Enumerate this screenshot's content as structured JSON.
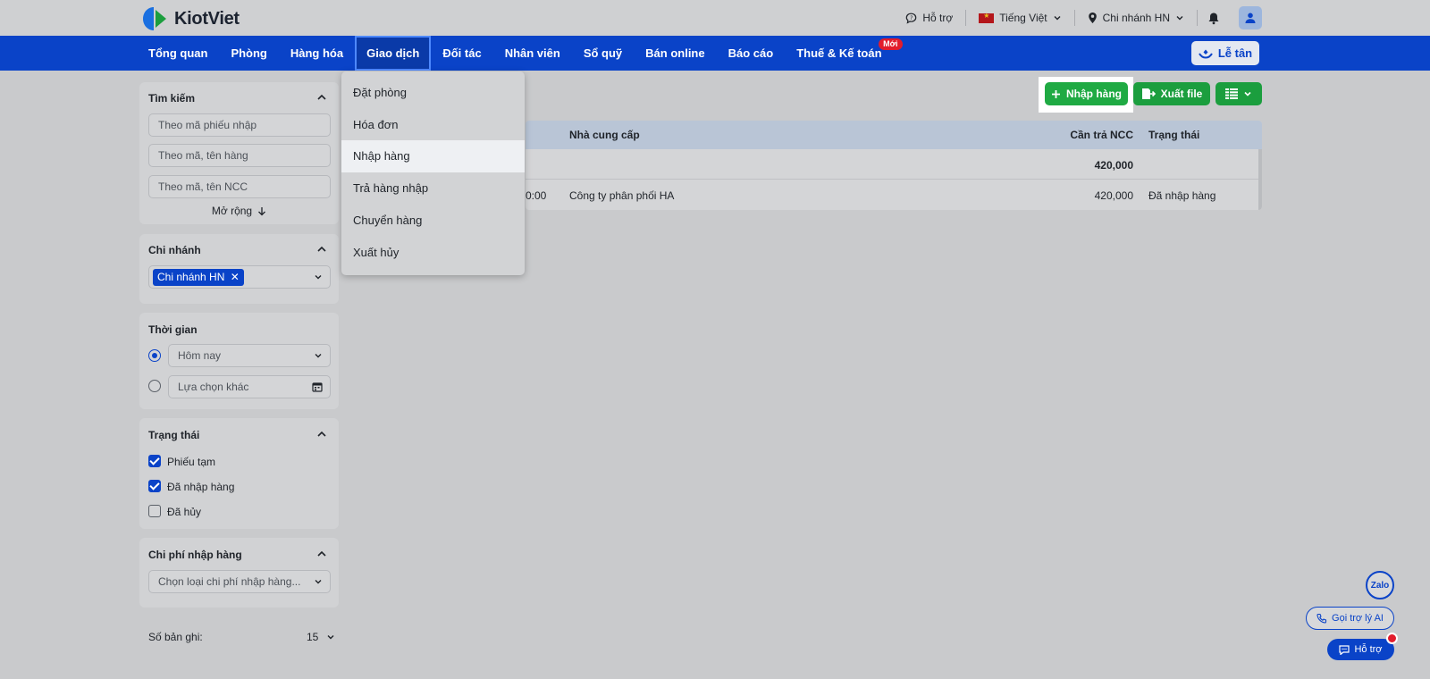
{
  "brand": {
    "name": "KiotViet"
  },
  "header": {
    "support": "Hỗ trợ",
    "language": "Tiếng Việt",
    "branch": "Chi nhánh HN"
  },
  "nav": {
    "items": [
      "Tổng quan",
      "Phòng",
      "Hàng hóa",
      "Giao dịch",
      "Đối tác",
      "Nhân viên",
      "Sổ quỹ",
      "Bán online",
      "Báo cáo",
      "Thuế & Kế toán"
    ],
    "active": "Giao dịch",
    "new_badge": "Mới",
    "reception": "Lễ tân"
  },
  "dropdown": {
    "items": [
      "Đặt phòng",
      "Hóa đơn",
      "Nhập hàng",
      "Trả hàng nhập",
      "Chuyển hàng",
      "Xuất hủy"
    ],
    "active": "Nhập hàng"
  },
  "sidebar": {
    "search": {
      "title": "Tìm kiếm",
      "placeholders": [
        "Theo mã phiếu nhập",
        "Theo mã, tên hàng",
        "Theo mã, tên NCC"
      ],
      "expand": "Mở rộng"
    },
    "branch": {
      "title": "Chi nhánh",
      "selected": "Chi nhánh HN"
    },
    "time": {
      "title": "Thời gian",
      "option1": "Hôm nay",
      "option2": "Lựa chọn khác"
    },
    "status": {
      "title": "Trạng thái",
      "options": [
        {
          "label": "Phiếu tạm",
          "checked": true
        },
        {
          "label": "Đã nhập hàng",
          "checked": true
        },
        {
          "label": "Đã hủy",
          "checked": false
        }
      ]
    },
    "cost": {
      "title": "Chi phí nhập hàng",
      "placeholder": "Chọn loại chi phí nhập hàng..."
    }
  },
  "toolbar": {
    "add": "Nhập hàng",
    "export": "Xuất file"
  },
  "table": {
    "headers": {
      "supplier": "Nhà cung cấp",
      "payable": "Cần trả NCC",
      "status": "Trạng thái"
    },
    "summary": {
      "payable": "420,000"
    },
    "rows": [
      {
        "time_tail": "0:00",
        "supplier": "Công ty phân phối HA",
        "payable": "420,000",
        "status": "Đã nhập hàng"
      }
    ]
  },
  "footer": {
    "records_label": "Số bản ghi:",
    "records_value": "15"
  },
  "floating": {
    "zalo": "Zalo",
    "ai": "Gọi trợ lý AI",
    "help": "Hỗ trợ"
  },
  "colors": {
    "primary": "#0a43c8",
    "green": "#1b9e3e",
    "badge": "#e21c2c"
  }
}
